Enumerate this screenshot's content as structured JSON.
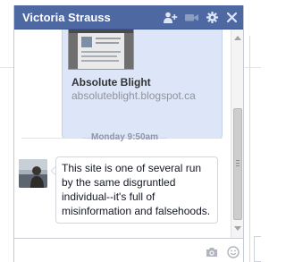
{
  "window": {
    "title": "Victoria Strauss",
    "icons": {
      "add_user": "add-user-icon",
      "video": "video-call-icon",
      "settings": "gear-icon",
      "close": "close-icon"
    }
  },
  "link_preview": {
    "title": "Absolute Blight",
    "domain": "absoluteblight.blogspot.ca"
  },
  "timestamp": "Monday 9:50am",
  "message": {
    "text": "This site is one of several run by the same disgruntled individual--it's full of misinformation and falsehoods."
  },
  "composer": {
    "value": "",
    "placeholder": "",
    "icons": {
      "camera": "camera-icon",
      "emoji": "emoji-icon"
    }
  },
  "colors": {
    "titlebar": "#4e69a2",
    "link_card_bg": "#dce6f8",
    "timestamp_text": "#9197a3"
  }
}
